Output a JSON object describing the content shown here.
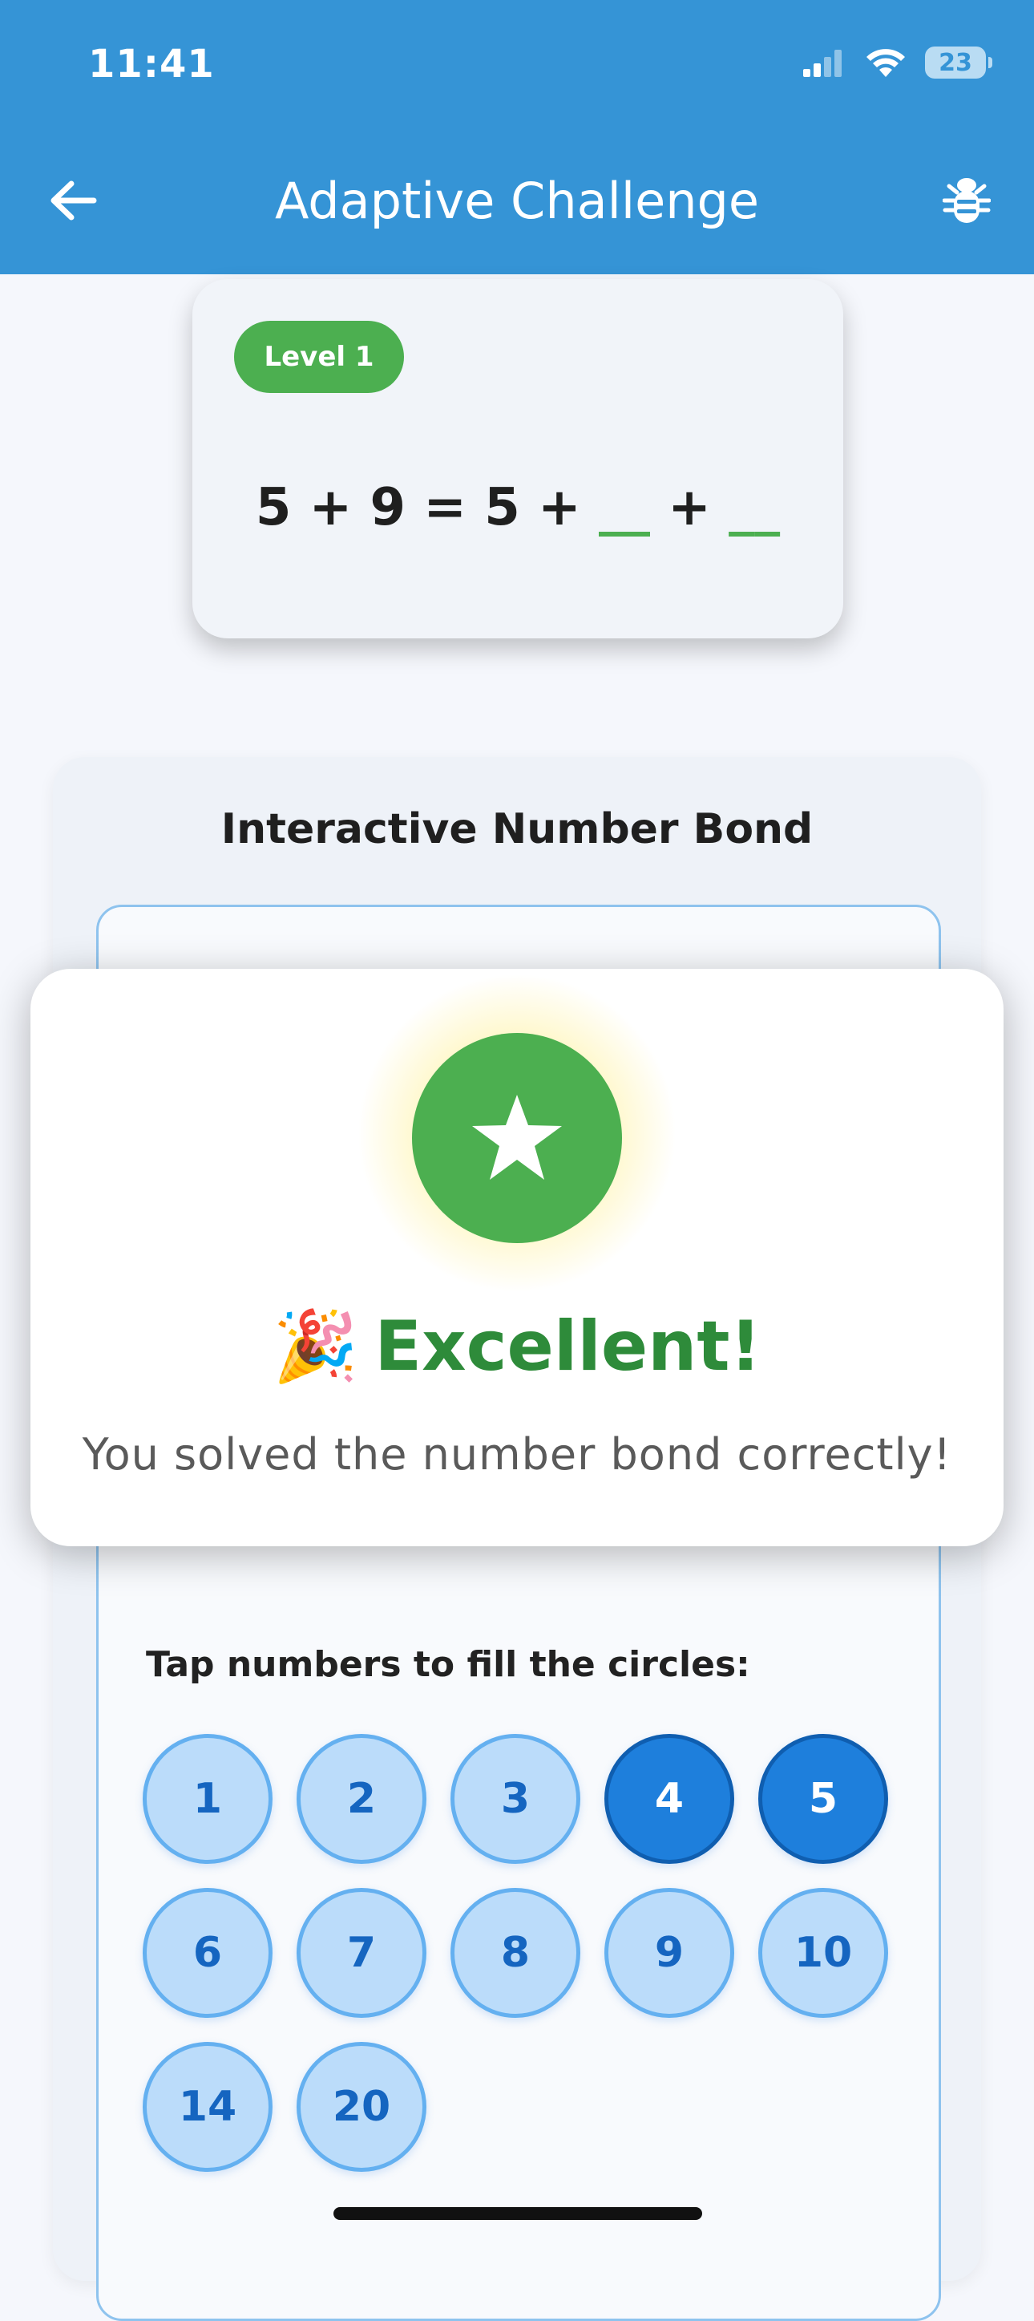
{
  "status_bar": {
    "time": "11:41",
    "battery": "23"
  },
  "header": {
    "title": "Adaptive Challenge",
    "back_icon": "arrow-left-icon",
    "action_icon": "bug-icon"
  },
  "challenge": {
    "level": "Level 1",
    "equation_left": "5 + 9 = 5 + ",
    "blank_1": "__",
    "operator": " + ",
    "blank_2": "__"
  },
  "bond_panel": {
    "title": "Interactive Number Bond",
    "tap_label": "Tap numbers to fill the circles:",
    "numbers": [
      {
        "value": "1",
        "selected": false
      },
      {
        "value": "2",
        "selected": false
      },
      {
        "value": "3",
        "selected": false
      },
      {
        "value": "4",
        "selected": true
      },
      {
        "value": "5",
        "selected": true
      },
      {
        "value": "6",
        "selected": false
      },
      {
        "value": "7",
        "selected": false
      },
      {
        "value": "8",
        "selected": false
      },
      {
        "value": "9",
        "selected": false
      },
      {
        "value": "10",
        "selected": false
      },
      {
        "value": "14",
        "selected": false
      },
      {
        "value": "20",
        "selected": false
      }
    ]
  },
  "success_dialog": {
    "emoji": "🎉",
    "title": "Excellent!",
    "message": "You solved the number bond correctly!",
    "icon": "star-icon"
  },
  "colors": {
    "header": "#3594d6",
    "success_green": "#4caf50",
    "selected_blue": "#1e7fdc",
    "unselected_blue": "#bbdcfa"
  }
}
